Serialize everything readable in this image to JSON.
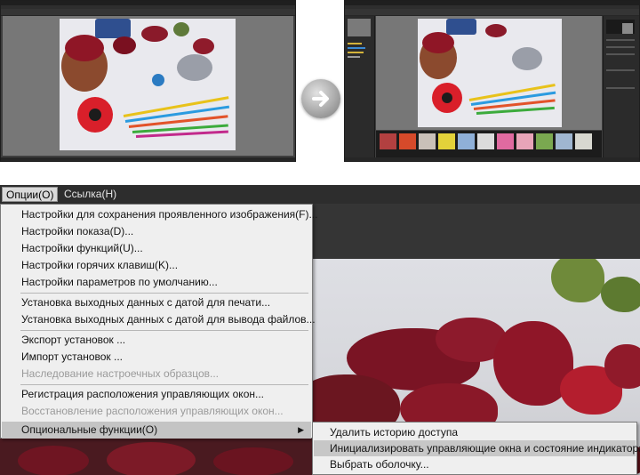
{
  "menubar": {
    "options": "Опции(O)",
    "link": "Ссылка(H)"
  },
  "options_menu": {
    "items": [
      "Настройки для сохранения проявленного изображения(F)...",
      "Настройки показа(D)...",
      "Настройки функций(U)...",
      "Настройки горячих клавиш(K)...",
      "Настройки параметров по умолчанию...",
      "Установка выходных данных с датой для печати...",
      "Установка выходных данных с датой для вывода файлов...",
      "Экспорт установок ...",
      "Импорт установок ...",
      "Наследование настроечных образцов...",
      "Регистрация расположения управляющих окон...",
      "Восстановление расположения управляющих окон...",
      "Опциональные функции(O)"
    ],
    "disabled": [
      9,
      11
    ],
    "highlighted": 12
  },
  "optional_functions_submenu": {
    "items": [
      "Удалить историю доступа",
      "Инициализировать управляющие окна и состояние индикатора",
      "Выбрать оболочку..."
    ],
    "highlighted": 1
  },
  "icons": {
    "transition_arrow": "arrow-right-icon",
    "submenu_arrow": "chevron-right-icon"
  },
  "colors": {
    "app_dark": "#3f3f3f",
    "menu_bg": "#efefef",
    "menu_highlight": "#c4c4c4",
    "disabled_text": "#9a9a9a"
  }
}
